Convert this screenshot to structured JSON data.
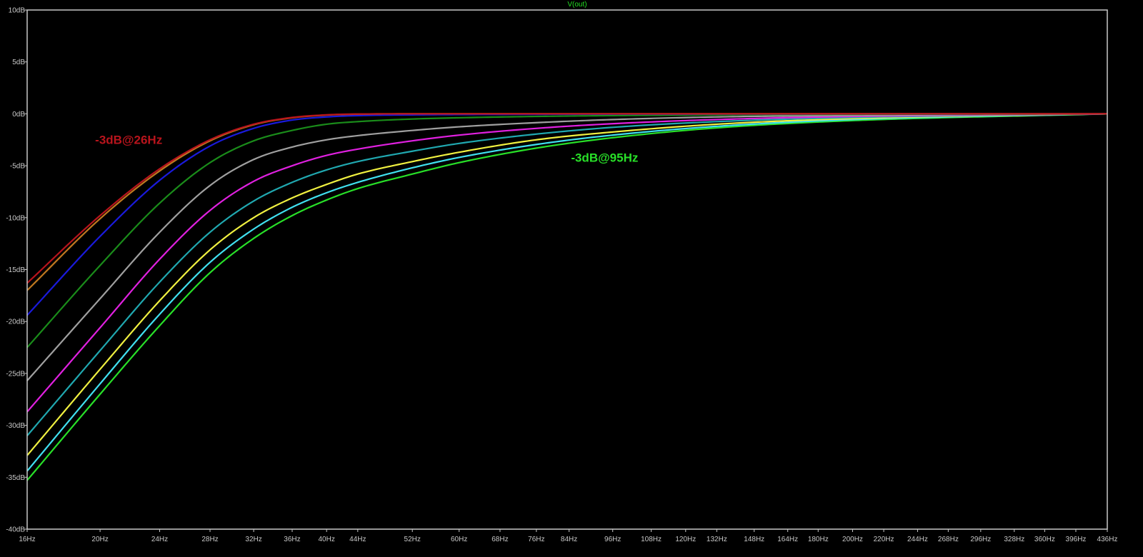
{
  "chart_data": {
    "type": "line",
    "title": "V(out)",
    "xlabel": "",
    "ylabel": "",
    "x_scale": "log",
    "xlim": [
      16,
      436
    ],
    "ylim": [
      -40,
      10
    ],
    "grid": false,
    "legend": "none",
    "x_ticks": [
      {
        "value": 16,
        "label": "16Hz"
      },
      {
        "value": 20,
        "label": "20Hz"
      },
      {
        "value": 24,
        "label": "24Hz"
      },
      {
        "value": 28,
        "label": "28Hz"
      },
      {
        "value": 32,
        "label": "32Hz"
      },
      {
        "value": 36,
        "label": "36Hz"
      },
      {
        "value": 40,
        "label": "40Hz"
      },
      {
        "value": 44,
        "label": "44Hz"
      },
      {
        "value": 52,
        "label": "52Hz"
      },
      {
        "value": 60,
        "label": "60Hz"
      },
      {
        "value": 68,
        "label": "68Hz"
      },
      {
        "value": 76,
        "label": "76Hz"
      },
      {
        "value": 84,
        "label": "84Hz"
      },
      {
        "value": 96,
        "label": "96Hz"
      },
      {
        "value": 108,
        "label": "108Hz"
      },
      {
        "value": 120,
        "label": "120Hz"
      },
      {
        "value": 132,
        "label": "132Hz"
      },
      {
        "value": 148,
        "label": "148Hz"
      },
      {
        "value": 164,
        "label": "164Hz"
      },
      {
        "value": 180,
        "label": "180Hz"
      },
      {
        "value": 200,
        "label": "200Hz"
      },
      {
        "value": 220,
        "label": "220Hz"
      },
      {
        "value": 244,
        "label": "244Hz"
      },
      {
        "value": 268,
        "label": "268Hz"
      },
      {
        "value": 296,
        "label": "296Hz"
      },
      {
        "value": 328,
        "label": "328Hz"
      },
      {
        "value": 360,
        "label": "360Hz"
      },
      {
        "value": 396,
        "label": "396Hz"
      },
      {
        "value": 436,
        "label": "436Hz"
      }
    ],
    "y_ticks": [
      {
        "value": 10,
        "label": "10dB"
      },
      {
        "value": 5,
        "label": "5dB"
      },
      {
        "value": 0,
        "label": "0dB"
      },
      {
        "value": -5,
        "label": "-5dB"
      },
      {
        "value": -10,
        "label": "-10dB"
      },
      {
        "value": -15,
        "label": "-15dB"
      },
      {
        "value": -20,
        "label": "-20dB"
      },
      {
        "value": -25,
        "label": "-25dB"
      },
      {
        "value": -30,
        "label": "-30dB"
      },
      {
        "value": -35,
        "label": "-35dB"
      },
      {
        "value": -40,
        "label": "-40dB"
      }
    ],
    "series": [
      {
        "color": "#b8141c",
        "x": [
          16,
          20,
          24,
          28,
          32,
          36,
          40,
          44,
          52,
          60,
          76,
          96,
          132,
          200,
          436
        ],
        "y": [
          -16.3,
          -9.8,
          -5.3,
          -2.5,
          -1.0,
          -0.35,
          -0.1,
          -0.02,
          0,
          0,
          0,
          0,
          0,
          0,
          0
        ]
      },
      {
        "color": "#c07820",
        "x": [
          16,
          20,
          24,
          28,
          32,
          36,
          40,
          44,
          52,
          60,
          76,
          96,
          132,
          200,
          436
        ],
        "y": [
          -17.0,
          -10.1,
          -5.5,
          -2.6,
          -1.05,
          -0.38,
          -0.12,
          -0.03,
          0,
          0,
          0,
          0,
          0,
          0,
          0
        ]
      },
      {
        "color": "#1a1adc",
        "x": [
          16,
          20,
          24,
          28,
          32,
          36,
          40,
          44,
          52,
          60,
          76,
          96,
          132,
          200,
          436
        ],
        "y": [
          -19.4,
          -11.8,
          -6.4,
          -3.1,
          -1.4,
          -0.6,
          -0.3,
          -0.17,
          -0.1,
          -0.07,
          -0.05,
          -0.03,
          -0.02,
          -0.01,
          0
        ]
      },
      {
        "color": "#1a8c1a",
        "x": [
          16,
          20,
          24,
          28,
          32,
          36,
          40,
          44,
          52,
          60,
          76,
          96,
          132,
          200,
          436
        ],
        "y": [
          -22.5,
          -14.6,
          -8.6,
          -4.7,
          -2.6,
          -1.6,
          -1.0,
          -0.75,
          -0.5,
          -0.38,
          -0.25,
          -0.17,
          -0.1,
          -0.05,
          0
        ]
      },
      {
        "color": "#a0a0a0",
        "x": [
          16,
          20,
          24,
          28,
          32,
          36,
          40,
          44,
          52,
          60,
          76,
          96,
          132,
          200,
          436
        ],
        "y": [
          -25.7,
          -17.8,
          -11.4,
          -6.9,
          -4.4,
          -3.2,
          -2.5,
          -2.1,
          -1.6,
          -1.25,
          -0.85,
          -0.55,
          -0.3,
          -0.15,
          0
        ]
      },
      {
        "color": "#e020e0",
        "x": [
          16,
          20,
          24,
          28,
          32,
          36,
          40,
          44,
          52,
          60,
          76,
          96,
          132,
          200,
          436
        ],
        "y": [
          -28.7,
          -20.6,
          -14.0,
          -9.3,
          -6.5,
          -5.0,
          -4.0,
          -3.4,
          -2.6,
          -2.05,
          -1.4,
          -0.95,
          -0.55,
          -0.25,
          0
        ]
      },
      {
        "color": "#20a8b0",
        "x": [
          16,
          20,
          24,
          28,
          32,
          36,
          40,
          44,
          52,
          60,
          76,
          96,
          132,
          200,
          436
        ],
        "y": [
          -31.0,
          -22.8,
          -16.2,
          -11.4,
          -8.4,
          -6.6,
          -5.4,
          -4.6,
          -3.6,
          -2.85,
          -1.95,
          -1.3,
          -0.75,
          -0.35,
          0
        ]
      },
      {
        "color": "#f0f040",
        "x": [
          16,
          20,
          24,
          28,
          32,
          36,
          40,
          44,
          52,
          60,
          76,
          96,
          132,
          200,
          436
        ],
        "y": [
          -32.9,
          -24.6,
          -18.0,
          -13.1,
          -10.0,
          -8.1,
          -6.8,
          -5.8,
          -4.6,
          -3.7,
          -2.5,
          -1.75,
          -1.0,
          -0.45,
          0
        ]
      },
      {
        "color": "#40e0f0",
        "x": [
          16,
          20,
          24,
          28,
          32,
          36,
          40,
          44,
          52,
          60,
          76,
          96,
          132,
          200,
          436
        ],
        "y": [
          -34.4,
          -26.0,
          -19.3,
          -14.3,
          -11.1,
          -9.0,
          -7.6,
          -6.6,
          -5.2,
          -4.2,
          -2.95,
          -2.05,
          -1.2,
          -0.55,
          0
        ]
      },
      {
        "color": "#28e028",
        "x": [
          16,
          20,
          24,
          28,
          32,
          36,
          40,
          44,
          52,
          60,
          76,
          96,
          132,
          200,
          436
        ],
        "y": [
          -35.3,
          -27.0,
          -20.4,
          -15.3,
          -12.0,
          -9.8,
          -8.3,
          -7.2,
          -5.8,
          -4.7,
          -3.3,
          -2.3,
          -1.35,
          -0.65,
          0
        ]
      }
    ],
    "annotations": [
      {
        "text": "-3dB@26Hz",
        "color": "#b8141c",
        "x": 19.7,
        "y": -2.9
      },
      {
        "text": "-3dB@95Hz",
        "color": "#28e028",
        "x": 84.5,
        "y": -4.6
      }
    ]
  }
}
